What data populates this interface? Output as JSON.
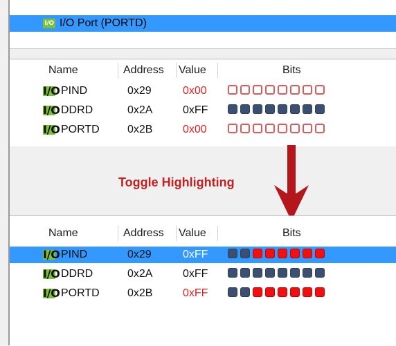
{
  "top_panel": {
    "icon": "I/O",
    "label": "I/O Port (PORTD)"
  },
  "columns": {
    "name": "Name",
    "address": "Address",
    "value": "Value",
    "bits": "Bits"
  },
  "before": {
    "rows": [
      {
        "icon": "I/O",
        "name": "PIND",
        "address": "0x29",
        "value": "0x00",
        "value_highlighted": true,
        "bits": [
          "off",
          "off",
          "off",
          "off",
          "off",
          "off",
          "off",
          "off"
        ]
      },
      {
        "icon": "I/O",
        "name": "DDRD",
        "address": "0x2A",
        "value": "0xFF",
        "value_highlighted": false,
        "bits": [
          "blue",
          "blue",
          "blue",
          "blue",
          "blue",
          "blue",
          "blue",
          "blue"
        ]
      },
      {
        "icon": "I/O",
        "name": "PORTD",
        "address": "0x2B",
        "value": "0x00",
        "value_highlighted": true,
        "bits": [
          "off",
          "off",
          "off",
          "off",
          "off",
          "off",
          "off",
          "off"
        ]
      }
    ]
  },
  "annotation": {
    "label": "Toggle Highlighting",
    "arrow_color": "#b3161b"
  },
  "after": {
    "rows": [
      {
        "icon": "I/O",
        "name": "PIND",
        "address": "0x29",
        "value": "0xFF",
        "value_highlighted": false,
        "selected": true,
        "bits": [
          "blue",
          "blue",
          "red",
          "red",
          "red",
          "red",
          "red",
          "red"
        ]
      },
      {
        "icon": "I/O",
        "name": "DDRD",
        "address": "0x2A",
        "value": "0xFF",
        "value_highlighted": false,
        "bits": [
          "blue",
          "blue",
          "blue",
          "blue",
          "blue",
          "blue",
          "blue",
          "blue"
        ]
      },
      {
        "icon": "I/O",
        "name": "PORTD",
        "address": "0x2B",
        "value": "0xFF",
        "value_highlighted": true,
        "bits": [
          "blue",
          "blue",
          "red",
          "red",
          "red",
          "red",
          "red",
          "red"
        ]
      }
    ]
  },
  "colors": {
    "selection": "#3399ff",
    "highlight_red": "#e02020",
    "bit_blue": "#3b5071",
    "bit_red": "#ee1111",
    "io_icon_green": "#7cbf3a"
  }
}
